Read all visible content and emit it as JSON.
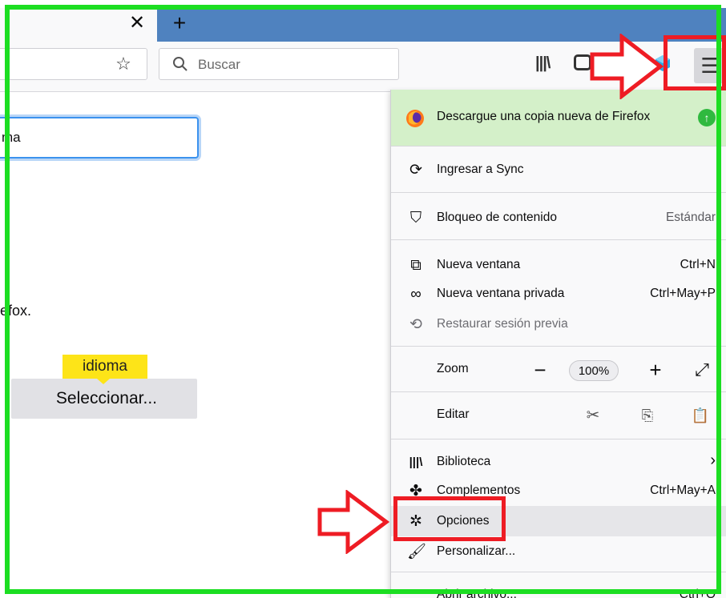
{
  "browser": {
    "tab": {
      "close_glyph": "✕",
      "new_tab_glyph": "+"
    },
    "toolbar": {
      "bookmark_icon": "star-icon",
      "search_placeholder": "Buscar",
      "menu_icon": "hamburger-menu-icon"
    }
  },
  "page": {
    "search_field_value": "ma",
    "body_text": "refox.",
    "tooltip_badge": "idioma",
    "select_button_label": "Seleccionar..."
  },
  "menu": {
    "update_banner": "Descargue una copia nueva de Firefox",
    "items": [
      {
        "label": "Ingresar a Sync",
        "shortcut": "",
        "icon": "sync-icon"
      },
      {
        "label": "Bloqueo de contenido",
        "shortcut": "Estándar",
        "icon": "shield-icon"
      },
      {
        "label": "Nueva ventana",
        "shortcut": "Ctrl+N",
        "icon": "new-window-icon"
      },
      {
        "label": "Nueva ventana privada",
        "shortcut": "Ctrl+May+P",
        "icon": "private-mask-icon"
      },
      {
        "label": "Restaurar sesión previa",
        "shortcut": "",
        "icon": "restore-session-icon"
      },
      {
        "label": "Biblioteca",
        "shortcut": "›",
        "icon": "library-icon"
      },
      {
        "label": "Complementos",
        "shortcut": "Ctrl+May+A",
        "icon": "puzzle-icon"
      },
      {
        "label": "Opciones",
        "shortcut": "",
        "icon": "gear-icon"
      },
      {
        "label": "Personalizar...",
        "shortcut": "",
        "icon": "paintbrush-icon"
      },
      {
        "label": "Abrir archivo...",
        "shortcut": "Ctrl+O",
        "icon": "folder-icon"
      }
    ],
    "zoom": {
      "label": "Zoom",
      "minus": "−",
      "value": "100%",
      "plus": "+",
      "fullscreen": "⤢"
    },
    "edit": {
      "label": "Editar"
    }
  },
  "colors": {
    "annotation_red": "#ee1c24",
    "annotation_green": "#1cde22",
    "highlight_yellow": "#fde418",
    "update_green": "#d4f0c9",
    "tabstrip_blue": "#4f82bf"
  }
}
